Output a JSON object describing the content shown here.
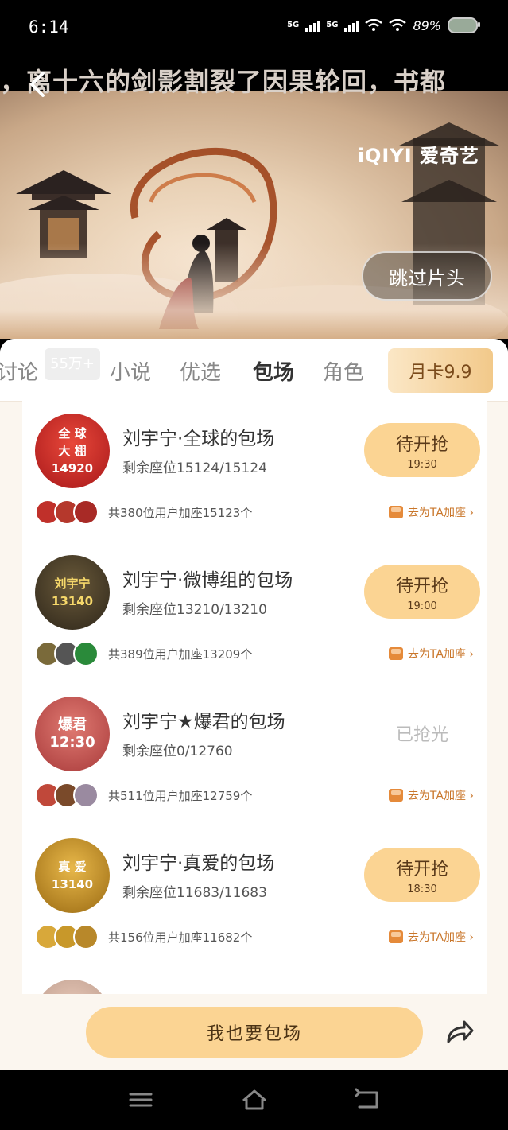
{
  "status": {
    "time": "6:14",
    "net1": "5G",
    "net2": "5G",
    "battery": "89%"
  },
  "video": {
    "danmaku": "，离十六的剑影割裂了因果轮回，书都",
    "logo": "iQIYI 爱奇艺",
    "skip_label": "跳过片头"
  },
  "tabs": {
    "items": [
      "讨论",
      "小说",
      "优选",
      "包场",
      "角色"
    ],
    "badge": "55万+",
    "month_card": "月卡9.9"
  },
  "items": [
    {
      "title": "刘宇宁·全球的包场",
      "seats": "剩余座位15124/15124",
      "join": "共380位用户加座15123个",
      "help": "去为TA加座 ›",
      "avatar_text": "全 球\n大 棚\n14920",
      "button_label": "待开抢",
      "button_time": "19:30",
      "sold_out": ""
    },
    {
      "title": "刘宇宁·微博组的包场",
      "seats": "剩余座位13210/13210",
      "join": "共389位用户加座13209个",
      "help": "去为TA加座 ›",
      "avatar_text": "刘宇宁\n13140",
      "button_label": "待开抢",
      "button_time": "19:00",
      "sold_out": ""
    },
    {
      "title": "刘宇宁★爆君的包场",
      "seats": "剩余座位0/12760",
      "join": "共511位用户加座12759个",
      "help": "去为TA加座 ›",
      "avatar_text": "爆君\n12:30",
      "button_label": "",
      "button_time": "",
      "sold_out": "已抢光"
    },
    {
      "title": "刘宇宁·真爱的包场",
      "seats": "剩余座位11683/11683",
      "join": "共156位用户加座11682个",
      "help": "去为TA加座 ›",
      "avatar_text": "真 爱\n13140",
      "button_label": "待开抢",
      "button_time": "18:30",
      "sold_out": ""
    }
  ],
  "cta_label": "我也要包场",
  "colors": {
    "accent": "#fbd493",
    "help": "#c9762a"
  }
}
